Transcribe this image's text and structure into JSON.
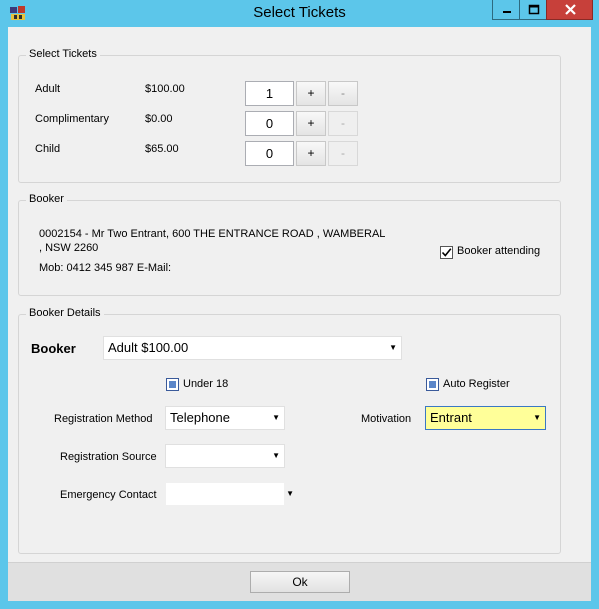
{
  "window": {
    "title": "Select Tickets",
    "minimize_icon": "minimize-icon",
    "maximize_icon": "maximize-icon",
    "close_icon": "close-icon",
    "app_icon": "ticket-app-icon"
  },
  "select_tickets": {
    "title": "Select Tickets",
    "rows": [
      {
        "label": "Adult",
        "price": "$100.00",
        "qty": "1",
        "plus": "+",
        "minus": "-",
        "minus_enabled": true
      },
      {
        "label": "Complimentary",
        "price": "$0.00",
        "qty": "0",
        "plus": "+",
        "minus": "-",
        "minus_enabled": false
      },
      {
        "label": "Child",
        "price": "$65.00",
        "qty": "0",
        "plus": "+",
        "minus": "-",
        "minus_enabled": false
      }
    ]
  },
  "booker": {
    "title": "Booker",
    "address_line1": "0002154 - Mr Two Entrant,  600 THE ENTRANCE ROAD , WAMBERAL",
    "address_line2": ", NSW 2260",
    "contact_line": "Mob: 0412 345 987 E-Mail:",
    "attending_label": "Booker attending",
    "attending_checked": true
  },
  "booker_details": {
    "title": "Booker Details",
    "booker_label": "Booker",
    "booker_value": "Adult $100.00",
    "under18_label": "Under 18",
    "auto_register_label": "Auto Register",
    "registration_method_label": "Registration Method",
    "registration_method_value": "Telephone",
    "motivation_label": "Motivation",
    "motivation_value": "Entrant",
    "registration_source_label": "Registration Source",
    "registration_source_value": "",
    "emergency_contact_label": "Emergency Contact",
    "emergency_contact_value": ""
  },
  "footer": {
    "ok_label": "Ok"
  },
  "colors": {
    "title_bar": "#5cc6ea",
    "close_button": "#c7403a",
    "motivation_highlight": "#ffff99"
  }
}
